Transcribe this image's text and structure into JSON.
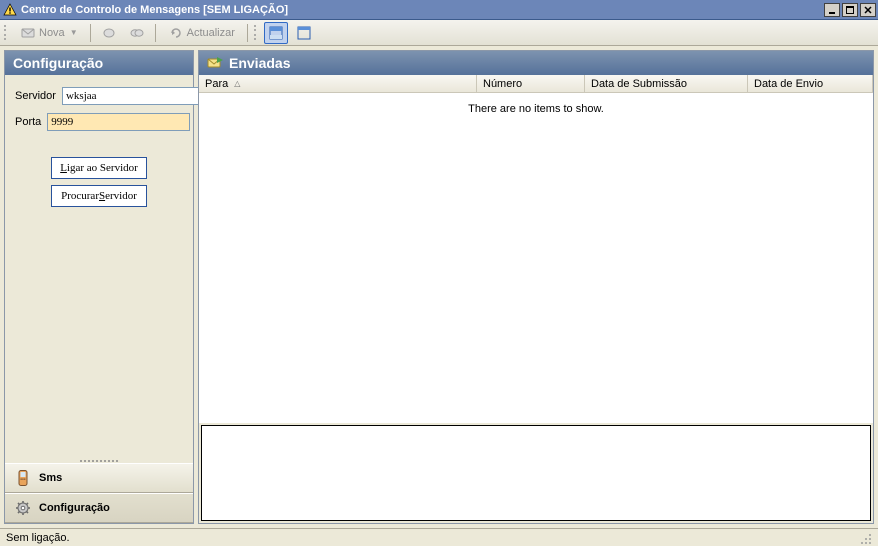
{
  "window": {
    "title": "Centro de Controlo de Mensagens [SEM LIGAÇÃO]"
  },
  "toolbar": {
    "nova_label": "Nova",
    "actualizar_label": "Actualizar"
  },
  "config": {
    "header": "Configuração",
    "servidor_label": "Servidor",
    "servidor_value": "wksjaa",
    "porta_label": "Porta",
    "porta_value": "9999",
    "ligar_pre": "",
    "ligar_u": "L",
    "ligar_post": "igar ao Servidor",
    "procurar_pre": "Procurar ",
    "procurar_u": "S",
    "procurar_post": "ervidor"
  },
  "nav": {
    "sms_label": "Sms",
    "config_label": "Configuração"
  },
  "sent": {
    "header": "Enviadas",
    "columns": {
      "para": "Para",
      "numero": "Número",
      "data_submissao": "Data de Submissão",
      "data_envio": "Data de Envio"
    },
    "empty_text": "There are no items to show."
  },
  "status": {
    "text": "Sem ligação."
  }
}
